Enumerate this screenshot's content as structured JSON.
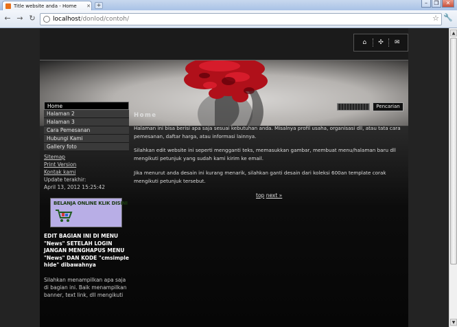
{
  "browser": {
    "tab_title": "Title website anda - Home",
    "new_tab": "+",
    "url_host": "localhost",
    "url_path": "/donlod/contoh/"
  },
  "colors": {
    "menu_bg": "#3a3a3a",
    "menu_active_bg": "#000000",
    "page_bg": "#232323",
    "ad_bg": "#b8aee6"
  },
  "icons": [
    "home-icon",
    "sitemap-icon",
    "mail-icon"
  ],
  "menu": [
    {
      "label": "Home",
      "active": true
    },
    {
      "label": "Halaman 2"
    },
    {
      "label": "Halaman 3"
    },
    {
      "label": "Cara Pemesanan"
    },
    {
      "label": "Hubungi Kami"
    },
    {
      "label": "Gallery foto"
    }
  ],
  "sidebar": {
    "sitemap": "Sitemap",
    "print_version": "Print Version",
    "contact": "Kontak kami",
    "updated_label": "Update terakhir:",
    "updated_date": "April 13, 2012 15:25:42",
    "ad_text": "BELANJA ONLINE KLIK DISINI",
    "heading": "EDIT BAGIAN INI DI MENU \"News\" SETELAH LOGIN JANGAN MENGHAPUS MENU \"News\" DAN KODE \"cmsimple hide\" dibawahnya",
    "para": "Silahkan menampilkan apa saja di bagian ini. Baik menampilkan banner, text link, dll mengikuti"
  },
  "search": {
    "button": "Pencarian"
  },
  "main": {
    "title": "Home",
    "p1": "Halaman ini bisa berisi apa saja sesuai kebutuhan anda. Misalnya profil usaha, organisasi dll, atau tata cara pemesanan, daftar harga, atau informasi lainnya.",
    "p2": "Silahkan edit website ini seperti mengganti teks, memasukkan gambar, membuat menu/halaman baru dll mengikuti petunjuk yang sudah kami kirim ke email.",
    "p3": "Jika menurut anda desain ini kurang menarik, silahkan ganti desain dari koleksi 600an template corak mengikuti petunjuk tersebut.",
    "nav_top": "top",
    "nav_next": "next »"
  }
}
